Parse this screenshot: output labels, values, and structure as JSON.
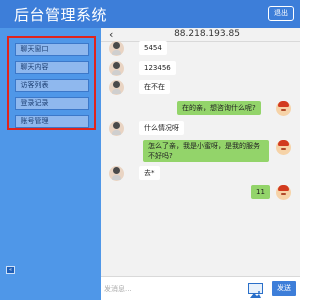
{
  "header": {
    "title": "后台管理系统",
    "logout_label": "退出"
  },
  "sidebar": {
    "items": [
      {
        "label": "聊天窗口"
      },
      {
        "label": "聊天内容"
      },
      {
        "label": "访客列表"
      },
      {
        "label": "登录记录"
      },
      {
        "label": "账号管理"
      }
    ],
    "collapse_icon": "«"
  },
  "chat": {
    "back_icon": "‹",
    "ip": "88.218.193.85",
    "messages": [
      {
        "side": "left",
        "text": "5454"
      },
      {
        "side": "left",
        "text": "123456"
      },
      {
        "side": "left",
        "text": "在不在"
      },
      {
        "side": "right",
        "text": "在的亲，想咨询什么呢?"
      },
      {
        "side": "left",
        "text": "什么情况呀"
      },
      {
        "side": "right",
        "text": "怎么了亲，我是小蜜呀，是我的服务不好吗?"
      },
      {
        "side": "left",
        "text": "去*"
      },
      {
        "side": "right",
        "text": "11"
      }
    ],
    "input_placeholder": "发消息...",
    "send_label": "发送"
  },
  "colors": {
    "header": "#3d7ed9",
    "sidebar": "#4f97e8",
    "menu_highlight_border": "#e0241c",
    "outgoing_bubble": "#93d46a",
    "incoming_bubble": "#ffffff"
  }
}
